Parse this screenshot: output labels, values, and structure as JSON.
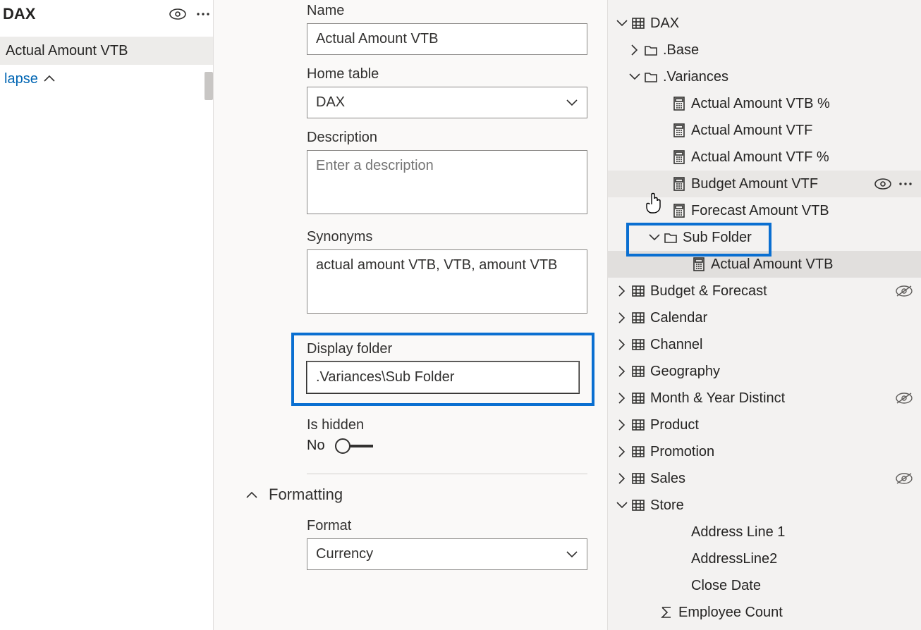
{
  "left": {
    "title": "DAX",
    "measure": "Actual Amount VTB",
    "collapse": "lapse"
  },
  "props": {
    "name_label": "Name",
    "name_value": "Actual Amount VTB",
    "home_table_label": "Home table",
    "home_table_value": "DAX",
    "description_label": "Description",
    "description_placeholder": "Enter a description",
    "description_value": "",
    "synonyms_label": "Synonyms",
    "synonyms_value": "actual amount VTB, VTB, amount VTB",
    "display_folder_label": "Display folder",
    "display_folder_value": ".Variances\\Sub Folder",
    "is_hidden_label": "Is hidden",
    "is_hidden_value": "No",
    "formatting_header": "Formatting",
    "format_label": "Format",
    "format_value": "Currency"
  },
  "tree": {
    "dax": "DAX",
    "base": ".Base",
    "variances": ".Variances",
    "v_items": [
      "Actual Amount VTB %",
      "Actual Amount VTF",
      "Actual Amount VTF %",
      "Budget Amount VTF",
      "Forecast Amount VTB"
    ],
    "subfolder": "Sub Folder",
    "subfolder_item": "Actual Amount VTB",
    "tables": [
      "Budget & Forecast",
      "Calendar",
      "Channel",
      "Geography",
      "Month & Year Distinct",
      "Product",
      "Promotion",
      "Sales",
      "Store"
    ],
    "store_cols": [
      "Address Line 1",
      "AddressLine2",
      "Close Date"
    ],
    "employee_count": "Employee Count"
  }
}
